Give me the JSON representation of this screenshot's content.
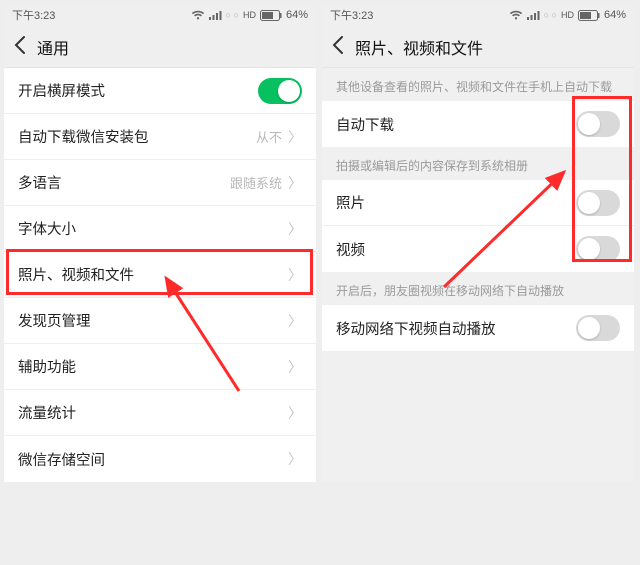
{
  "status": {
    "time": "下午3:23",
    "hd": "HD",
    "battery_pct": "64%"
  },
  "left": {
    "title": "通用",
    "rows": {
      "landscape": {
        "label": "开启横屏模式"
      },
      "auto_download_pkg": {
        "label": "自动下载微信安装包",
        "value": "从不"
      },
      "language": {
        "label": "多语言",
        "value": "跟随系统"
      },
      "font_size": {
        "label": "字体大小"
      },
      "media_files": {
        "label": "照片、视频和文件"
      },
      "discover": {
        "label": "发现页管理"
      },
      "accessibility": {
        "label": "辅助功能"
      },
      "data_usage": {
        "label": "流量统计"
      },
      "storage": {
        "label": "微信存储空间"
      }
    }
  },
  "right": {
    "title": "照片、视频和文件",
    "caption1": "其他设备查看的照片、视频和文件在手机上自动下载",
    "rows": {
      "auto_download": {
        "label": "自动下载"
      },
      "photos": {
        "label": "照片"
      },
      "videos": {
        "label": "视频"
      },
      "autoplay": {
        "label": "移动网络下视频自动播放"
      }
    },
    "caption2": "拍摄或编辑后的内容保存到系统相册",
    "caption3": "开启后，朋友圈视频在移动网络下自动播放"
  }
}
